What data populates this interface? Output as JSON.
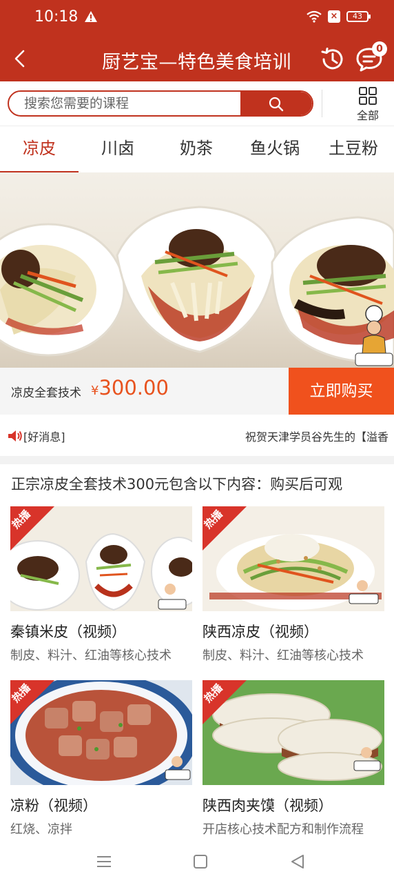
{
  "status": {
    "time": "10:18",
    "battery": "43",
    "sim_glyph": "×"
  },
  "header": {
    "title": "厨艺宝—特色美食培训",
    "message_badge": "0"
  },
  "search": {
    "placeholder": "搜索您需要的课程",
    "all_label": "全部"
  },
  "tabs": [
    {
      "label": "凉皮",
      "active": true
    },
    {
      "label": "川卤"
    },
    {
      "label": "奶茶"
    },
    {
      "label": "鱼火锅"
    },
    {
      "label": "土豆粉"
    }
  ],
  "product": {
    "label": "凉皮全套技术",
    "currency": "¥",
    "price": "300.00",
    "buy_label": "立即购买"
  },
  "news": {
    "tag": "[好消息]",
    "text": "祝贺天津学员谷先生的【溢香"
  },
  "intro": "正宗凉皮全套技术300元包含以下内容：购买后可观",
  "courses": [
    {
      "hot": "热播",
      "title": "秦镇米皮（视频）",
      "desc": "制皮、料汁、红油等核心技术"
    },
    {
      "hot": "热播",
      "title": "陕西凉皮（视频）",
      "desc": "制皮、料汁、红油等核心技术"
    },
    {
      "hot": "热播",
      "title": "凉粉（视频）",
      "desc": "红烧、凉拌"
    },
    {
      "hot": "热播",
      "title": "陕西肉夹馍（视频）",
      "desc": "开店核心技术配方和制作流程"
    }
  ],
  "colors": {
    "brand_red": "#c0321e",
    "price_orange": "#e8531f",
    "buy_button": "#f0511d"
  }
}
